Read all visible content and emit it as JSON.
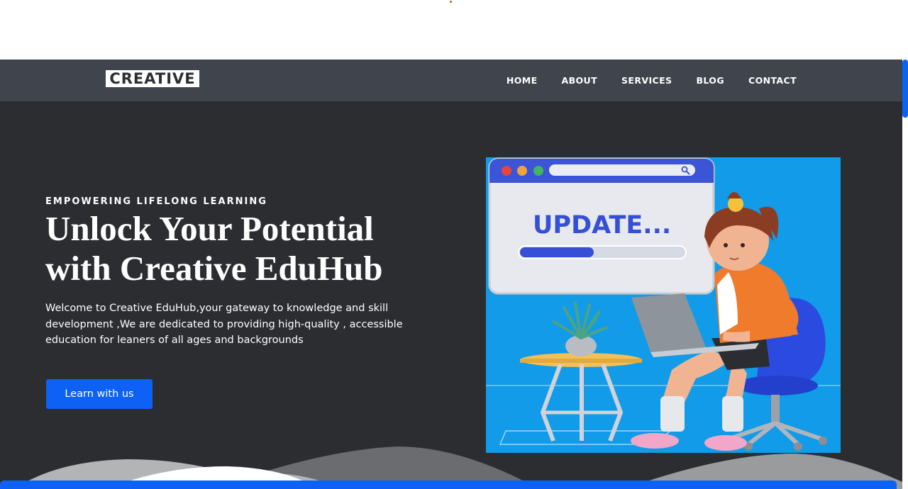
{
  "brand": {
    "logo_text": "CREATIVE"
  },
  "nav": {
    "items": [
      {
        "label": "HOME"
      },
      {
        "label": "ABOUT"
      },
      {
        "label": "SERVICES"
      },
      {
        "label": "BLOG"
      },
      {
        "label": "CONTACT"
      }
    ]
  },
  "hero": {
    "eyebrow": "EMPOWERING LIFELONG LEARNING",
    "headline_line1": "Unlock Your Potential",
    "headline_line2": "with Creative EduHub",
    "description": "Welcome to Creative EduHub,your gateway to knowledge and skill development ,We are dedicated to providing high-quality , accessible education for leaners of all ages and backgrounds",
    "cta_label": "Learn with us"
  },
  "illustration": {
    "window_text": "UPDATE...",
    "progress": 0.45,
    "icon": "search-icon"
  },
  "colors": {
    "navbar_bg": "#40444c",
    "hero_bg": "#2b2d31",
    "accent": "#0d62f5",
    "illustration_bg": "#119be9"
  }
}
